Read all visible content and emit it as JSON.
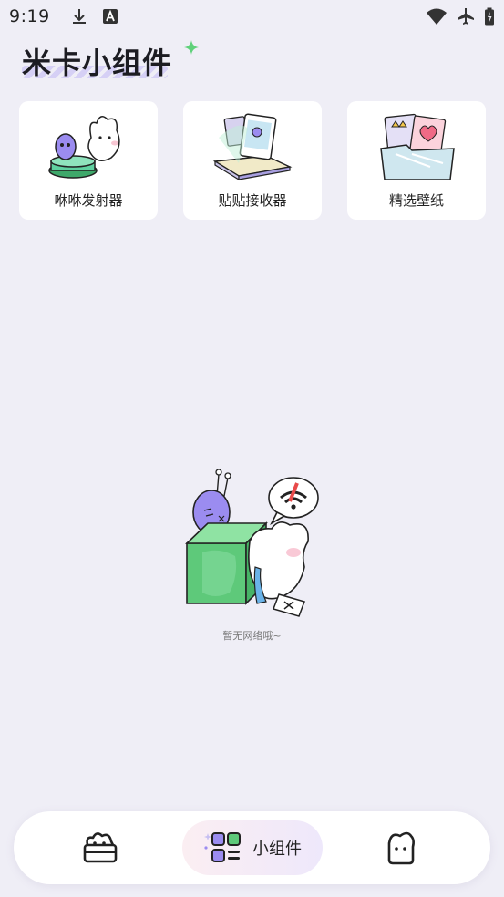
{
  "status_bar": {
    "time": "9:19",
    "left_icons": [
      "download-icon",
      "font-a-icon"
    ],
    "right_icons": [
      "wifi-icon",
      "airplane-mode-icon",
      "battery-icon"
    ]
  },
  "app": {
    "title": "米卡小组件",
    "accent_color": "#7ed67e",
    "underline_color": "#cfc8f5"
  },
  "cards": [
    {
      "label": "咻咻发射器",
      "icon": "launcher-illustration"
    },
    {
      "label": "贴贴接收器",
      "icon": "receiver-illustration"
    },
    {
      "label": "精选壁纸",
      "icon": "wallpaper-illustration"
    }
  ],
  "empty_state": {
    "message": "暂无网络哦~",
    "icon": "no-network-illustration"
  },
  "bottom_nav": {
    "items": [
      {
        "icon": "home-cat-icon",
        "label": ""
      },
      {
        "icon": "widgets-grid-icon",
        "label": "小组件",
        "active": true
      },
      {
        "icon": "profile-cat-icon",
        "label": ""
      }
    ],
    "active_gradient": [
      "#fbeef2",
      "#eee8fb"
    ]
  }
}
